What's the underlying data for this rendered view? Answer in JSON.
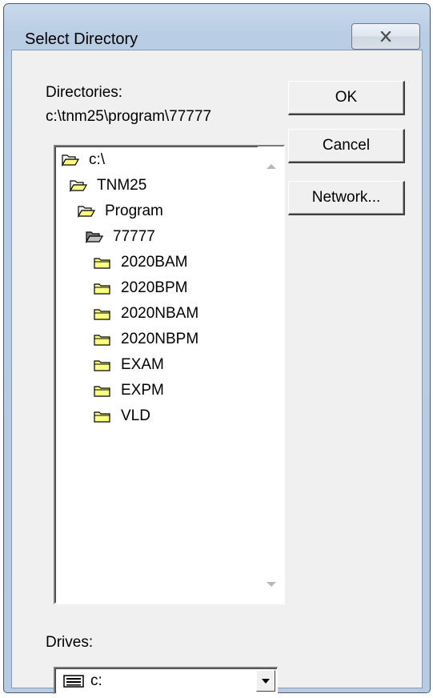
{
  "window": {
    "title": "Select Directory"
  },
  "directories": {
    "label": "Directories:",
    "current_path": "c:\\tnm25\\program\\77777",
    "tree": [
      {
        "name": "c:\\",
        "icon": "open-folder-icon"
      },
      {
        "name": "TNM25",
        "icon": "open-folder-icon"
      },
      {
        "name": "Program",
        "icon": "open-folder-icon"
      },
      {
        "name": "77777",
        "icon": "open-folder-selected-icon"
      },
      {
        "name": "2020BAM",
        "icon": "folder-icon"
      },
      {
        "name": "2020BPM",
        "icon": "folder-icon"
      },
      {
        "name": "2020NBAM",
        "icon": "folder-icon"
      },
      {
        "name": "2020NBPM",
        "icon": "folder-icon"
      },
      {
        "name": "EXAM",
        "icon": "folder-icon"
      },
      {
        "name": "EXPM",
        "icon": "folder-icon"
      },
      {
        "name": "VLD",
        "icon": "folder-icon"
      }
    ]
  },
  "buttons": {
    "ok": "OK",
    "cancel": "Cancel",
    "network": "Network..."
  },
  "drives": {
    "label": "Drives:",
    "selected": "c:",
    "icon": "drive-icon"
  },
  "colors": {
    "title_bar": "#b9cde5",
    "dialog_face": "#f0f0f0",
    "folder_yellow": "#ffff80"
  }
}
